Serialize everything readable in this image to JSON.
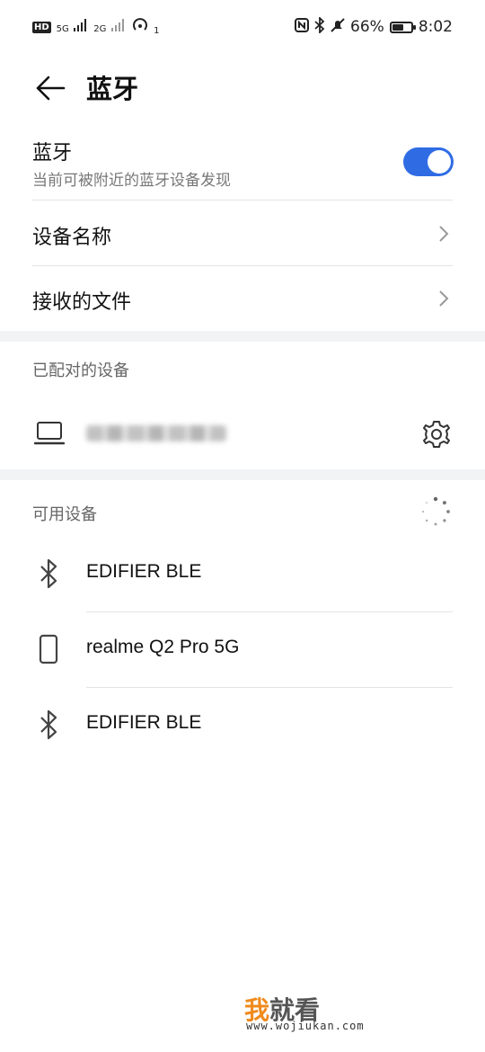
{
  "status_bar": {
    "hd_badge": "HD",
    "signal1": "5G",
    "signal2": "2G",
    "hotspot_sup": "1",
    "battery_percent": "66%",
    "time": "8:02",
    "battery_level": 0.66
  },
  "header": {
    "title": "蓝牙"
  },
  "bluetooth": {
    "title": "蓝牙",
    "subtitle": "当前可被附近的蓝牙设备发现",
    "enabled": true,
    "accent_color": "#2f6ce4"
  },
  "menu": {
    "device_name_label": "设备名称",
    "received_files_label": "接收的文件"
  },
  "paired": {
    "header": "已配对的设备"
  },
  "available": {
    "header": "可用设备",
    "devices": [
      {
        "name": "EDIFIER BLE",
        "icon": "bluetooth-icon"
      },
      {
        "name": "realme Q2 Pro 5G",
        "icon": "phone-icon"
      },
      {
        "name": "EDIFIER BLE",
        "icon": "bluetooth-icon"
      }
    ]
  },
  "watermark": {
    "char1": "我",
    "char2": "就看",
    "url": "www.wojiukan.com"
  }
}
